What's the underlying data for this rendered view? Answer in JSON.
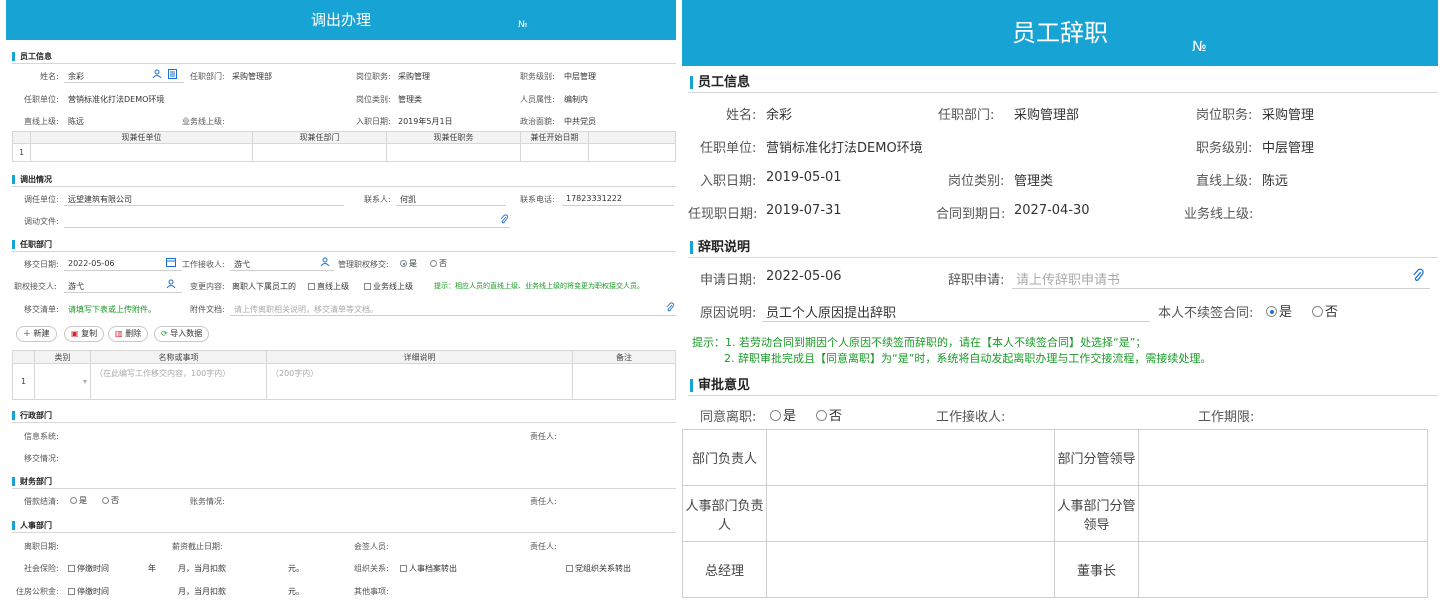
{
  "left": {
    "title": "调出办理",
    "no_label": "№",
    "sections": {
      "employee": "员工信息",
      "transfer": "调出情况",
      "dept": "任职部门",
      "admin": "行政部门",
      "finance": "财务部门",
      "hr": "人事部门"
    },
    "employee": {
      "name_label": "姓名:",
      "name_value": "余彩",
      "dept_label": "任职部门:",
      "dept_value": "采购管理部",
      "post_label": "岗位职务:",
      "post_value": "采购管理",
      "level_label": "职务级别:",
      "level_value": "中层管理",
      "unit_label": "任职单位:",
      "unit_value": "营销标准化打法DEMO环境",
      "post_type_label": "岗位类别:",
      "post_type_value": "管理类",
      "person_label": "人员属性:",
      "person_value": "编制内",
      "boss_label": "直线上级:",
      "boss_value": "陈远",
      "biz_label": "业务线上级:",
      "entry_label": "入职日期:",
      "entry_value": "2019年5月1日",
      "politics_label": "政治面貌:",
      "politics_value": "中共党员"
    },
    "concurrent_table": {
      "headers": [
        "现兼任单位",
        "现兼任部门",
        "现兼任职务",
        "兼任开始日期"
      ],
      "row_no": "1"
    },
    "transfer": {
      "unit_label": "调任单位:",
      "unit_value": "远望建筑有限公司",
      "contact_label": "联系人:",
      "contact_value": "何凯",
      "phone_label": "联系电话:",
      "phone_value": "17823331222",
      "file_label": "调动文件:"
    },
    "dept": {
      "date_label": "移交日期:",
      "date_value": "2022-05-06",
      "receiver_label": "工作接收人:",
      "receiver_value": "游弋",
      "mgr_label": "管理职权移交:",
      "yes": "是",
      "no": "否",
      "auth_label": "职权接交人:",
      "auth_value": "游弋",
      "change_label": "变更内容:",
      "change_value": "离职人下属员工的",
      "opt_direct": "直线上级",
      "opt_biz": "业务线上级",
      "tip": "提示：相应人员的直线上级、业务线上级的将变更为职权接交人员。",
      "list_label": "移交清单:",
      "list_value": "请填写下表或上传附件。",
      "attach_label": "附件文档:",
      "attach_placeholder": "请上传离职相关说明，移交清单等文档。"
    },
    "buttons": {
      "add": "新建",
      "copy": "复制",
      "delete": "删除",
      "import": "导入数据"
    },
    "items_table": {
      "headers": [
        "类别",
        "名称或事项",
        "详细说明",
        "备注"
      ],
      "row_no": "1",
      "name_ph": "（在此编写工作移交内容，100字内）",
      "detail_ph": "（200字内）"
    },
    "admin": {
      "info_label": "信息系统:",
      "owner_label": "责任人:",
      "handover_label": "移交情况:"
    },
    "finance": {
      "loan_label": "借款结清:",
      "yes": "是",
      "no": "否",
      "account_label": "账务情况:",
      "owner_label": "责任人:"
    },
    "hr": {
      "leave_label": "离职日期:",
      "salary_label": "薪资截止日期:",
      "sign_label": "会签人员:",
      "owner_label": "责任人:",
      "social_label": "社会保险:",
      "stop_label": "停缴时间",
      "year": "年",
      "month_deduct": "月，当月扣款",
      "yuan": "元。",
      "org_label": "组织关系:",
      "archive": "人事档案转出",
      "party": "党组织关系转出",
      "fund_label": "住房公积金:",
      "stop_label2": "停缴时间",
      "month_deduct2": "月，当月扣款",
      "yuan2": "元。",
      "other_label": "其他事项:"
    }
  },
  "right": {
    "title": "员工辞职",
    "no_label": "№",
    "sections": {
      "employee": "员工信息",
      "resign": "辞职说明",
      "approval": "审批意见"
    },
    "employee": {
      "name_label": "姓名:",
      "name_value": "余彩",
      "dept_label": "任职部门:",
      "dept_value": "采购管理部",
      "post_label": "岗位职务:",
      "post_value": "采购管理",
      "unit_label": "任职单位:",
      "unit_value": "营销标准化打法DEMO环境",
      "level_label": "职务级别:",
      "level_value": "中层管理",
      "entry_label": "入职日期:",
      "entry_value": "2019-05-01",
      "post_type_label": "岗位类别:",
      "post_type_value": "管理类",
      "boss_label": "直线上级:",
      "boss_value": "陈远",
      "current_label": "任现职日期:",
      "current_value": "2019-07-31",
      "contract_label": "合同到期日:",
      "contract_value": "2027-04-30",
      "biz_label": "业务线上级:"
    },
    "resign": {
      "date_label": "申请日期:",
      "date_value": "2022-05-06",
      "apply_label": "辞职申请:",
      "apply_placeholder": "请上传辞职申请书",
      "reason_label": "原因说明:",
      "reason_value": "员工个人原因提出辞职",
      "renew_label": "本人不续签合同:",
      "yes": "是",
      "no": "否",
      "tip1": "提示：1. 若劳动合同到期因个人原因不续签而辞职的，请在【本人不续签合同】处选择“是”；",
      "tip2": "2. 辞职审批完成且【同意离职】为“是”时，系统将自动发起离职办理与工作交接流程，需接续处理。"
    },
    "approval": {
      "agree_label": "同意离职:",
      "yes": "是",
      "no": "否",
      "receiver_label": "工作接收人:",
      "period_label": "工作期限:",
      "dept_head": "部门负责人",
      "dept_lead": "部门分管领导",
      "hr_head": "人事部门负责人",
      "hr_lead": "人事部门分管领导",
      "gm": "总经理",
      "chairman": "董事长"
    }
  },
  "colors": {
    "accent": "#17a3d3",
    "tip_green": "#1a9a26",
    "link_blue": "#1a6fd1"
  },
  "icons": [
    "user-icon",
    "list-icon",
    "calendar-icon",
    "paperclip-icon",
    "plus-icon",
    "copy-icon",
    "trash-icon",
    "import-icon"
  ]
}
